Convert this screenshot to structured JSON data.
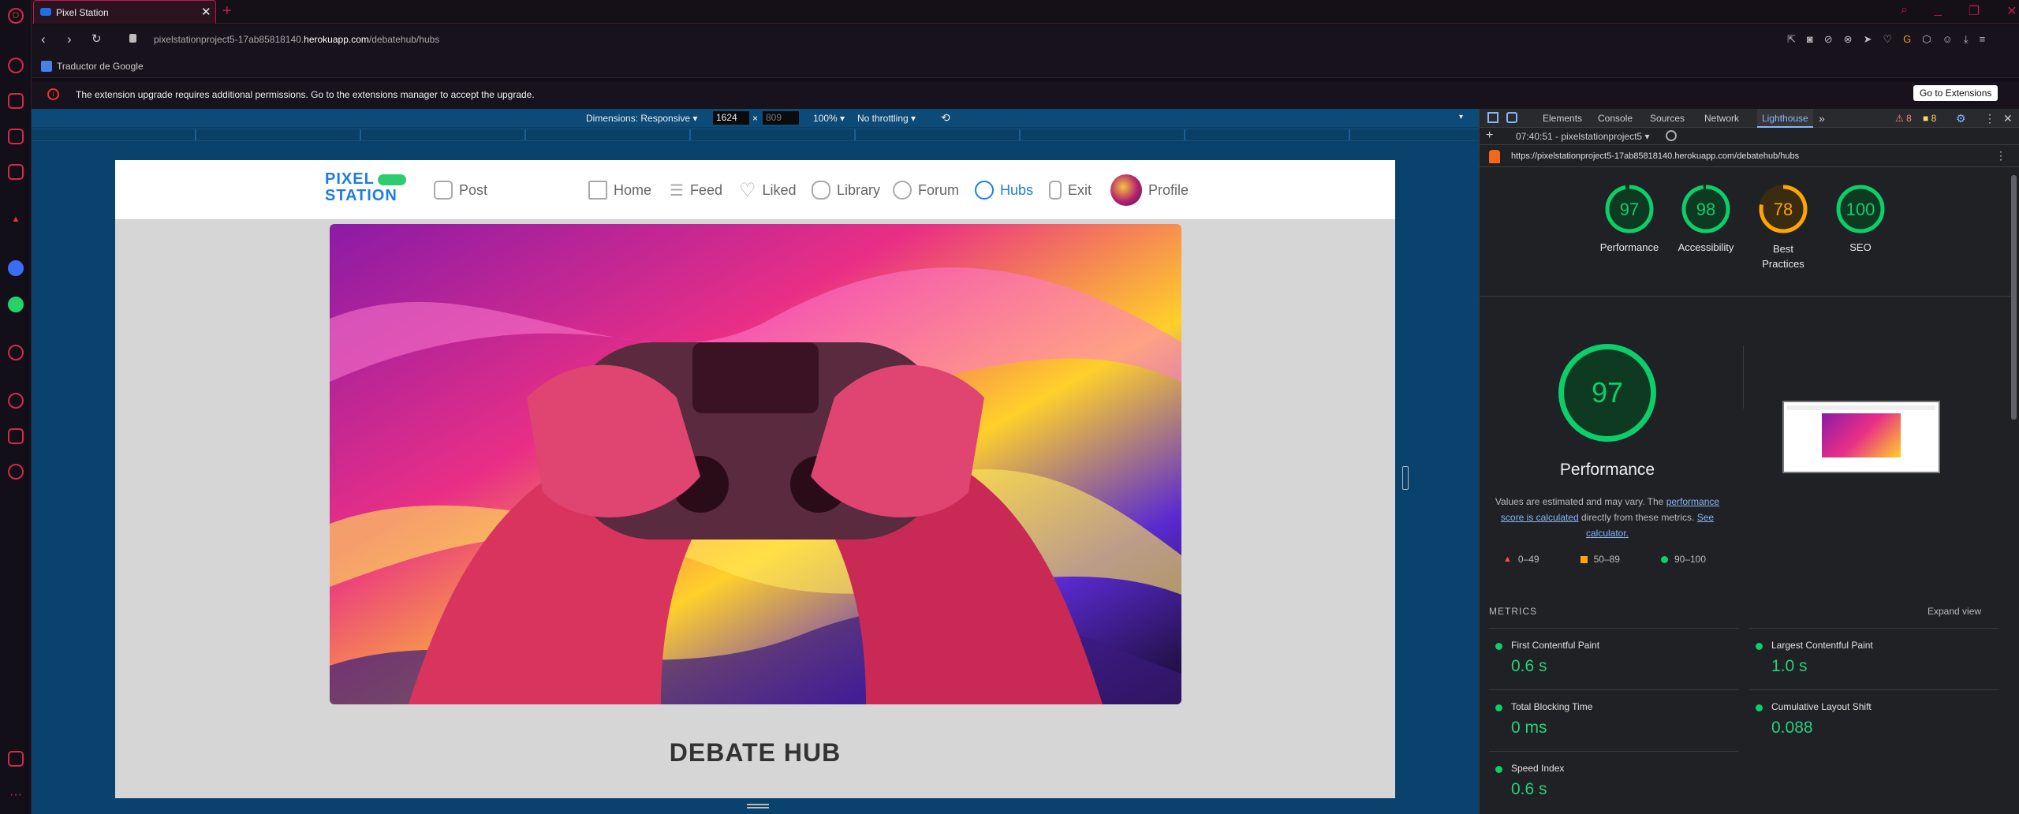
{
  "browser": {
    "tab_title": "Pixel Station",
    "url_prefix": "pixelstationproject5-17ab85818140.",
    "url_domain": "herokuapp.com",
    "url_path": "/debatehub/hubs",
    "bookmark": "Traductor de Google",
    "notice_text": "The extension upgrade requires additional permissions. Go to the extensions manager to accept the upgrade.",
    "notice_button": "Go to Extensions"
  },
  "device_toolbar": {
    "dimensions_label": "Dimensions: Responsive",
    "width": "1624",
    "height_placeholder": "809",
    "times": "×",
    "zoom": "100%",
    "throttling": "No throttling"
  },
  "site": {
    "logo_line1": "PIXEL",
    "logo_line2": "STATION",
    "nav": {
      "post": "Post",
      "home": "Home",
      "feed": "Feed",
      "liked": "Liked",
      "library": "Library",
      "forum": "Forum",
      "hubs": "Hubs",
      "exit": "Exit",
      "profile": "Profile"
    },
    "heading": "DEBATE HUB"
  },
  "devtools": {
    "tabs": [
      "Elements",
      "Console",
      "Sources",
      "Network",
      "Lighthouse"
    ],
    "warnings": "8",
    "errors": "8",
    "report_time": "07:40:51 - pixelstationproject5",
    "report_url": "https://pixelstationproject5-17ab85818140.herokuapp.com/debatehub/hubs",
    "scores": [
      {
        "label": "Performance",
        "value": "97",
        "score": 97,
        "color": "#0cce6b"
      },
      {
        "label": "Accessibility",
        "value": "98",
        "score": 98,
        "color": "#0cce6b"
      },
      {
        "label": "Best Practices",
        "value": "78",
        "score": 78,
        "color": "#ffa400"
      },
      {
        "label": "SEO",
        "value": "100",
        "score": 100,
        "color": "#0cce6b"
      }
    ],
    "big_score": "97",
    "big_label": "Performance",
    "desc_part1": "Values are estimated and may vary. The",
    "desc_link1": "performance score is calculated",
    "desc_part2": "directly from these metrics.",
    "desc_link2": "See calculator.",
    "legend_red": "0–49",
    "legend_orange": "50–89",
    "legend_green": "90–100",
    "metrics_title": "METRICS",
    "expand_view": "Expand view",
    "metrics": [
      {
        "name": "First Contentful Paint",
        "value": "0.6 s"
      },
      {
        "name": "Largest Contentful Paint",
        "value": "1.0 s"
      },
      {
        "name": "Total Blocking Time",
        "value": "0 ms"
      },
      {
        "name": "Cumulative Layout Shift",
        "value": "0.088"
      },
      {
        "name": "Speed Index",
        "value": "0.6 s"
      }
    ]
  }
}
